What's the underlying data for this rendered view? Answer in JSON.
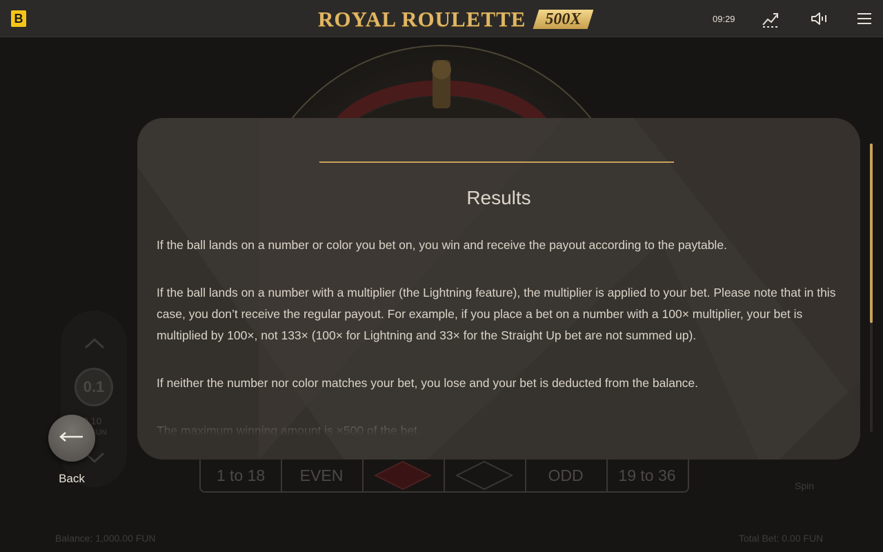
{
  "topbar": {
    "brand_letter": "B",
    "title": "ROYAL ROULETTE",
    "badge": "500X",
    "time": "09:29",
    "icons": [
      "chart-trend-icon",
      "sound-icon",
      "menu-icon"
    ]
  },
  "game": {
    "bets": [
      "1 to 18",
      "EVEN",
      "ODD",
      "19 to 36"
    ],
    "chip_value": "0.1",
    "stake_value": "0.10",
    "stake_unit": "FUN",
    "spin_label": "Spin",
    "balance": "Balance: 1,000.00 FUN",
    "total_bet": "Total Bet: 0.00 FUN"
  },
  "panel": {
    "title": "Results",
    "paragraphs": [
      "If the ball lands on a number or color you bet on, you win and receive the payout according to the paytable.",
      "If the ball lands on a number with a multiplier (the Lightning feature), the multiplier is applied to your bet. Please note that in this case, you don’t receive the regular payout. For example, if you place a bet on a number with a 100× multiplier, your bet is multiplied by 100×, not 133× (100× for Lightning and 33× for the Straight Up bet are not summed up).",
      "If neither the number nor color matches your bet, you lose and your bet is deducted from the balance.",
      "The maximum winning amount is ×500 of the bet."
    ]
  },
  "back": {
    "label": "Back"
  },
  "colors": {
    "accent_gold": "#c9a25b",
    "brand_yellow": "#f5c518",
    "panel_bg": "#3a3631"
  }
}
